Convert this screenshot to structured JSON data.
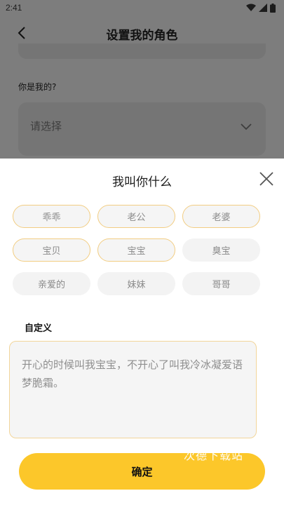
{
  "status": {
    "time": "2:41"
  },
  "header": {
    "title": "设置我的角色"
  },
  "background": {
    "question": "你是我的?",
    "select_placeholder": "请选择"
  },
  "sheet": {
    "title": "我叫你什么",
    "nicknames": [
      {
        "label": "乖乖",
        "selected": true
      },
      {
        "label": "老公",
        "selected": true
      },
      {
        "label": "老婆",
        "selected": true
      },
      {
        "label": "宝贝",
        "selected": true
      },
      {
        "label": "宝宝",
        "selected": true
      },
      {
        "label": "臭宝",
        "selected": false
      },
      {
        "label": "亲爱的",
        "selected": false
      },
      {
        "label": "妹妹",
        "selected": false
      },
      {
        "label": "哥哥",
        "selected": false
      }
    ],
    "custom_label": "自定义",
    "custom_text": "开心的时候叫我宝宝，不开心了叫我冷冰凝爱语梦脆霜。",
    "confirm_label": "确定",
    "watermark": "次德下载站"
  },
  "colors": {
    "accent": "#fcc72a",
    "chip_border": "#f2cd82"
  }
}
